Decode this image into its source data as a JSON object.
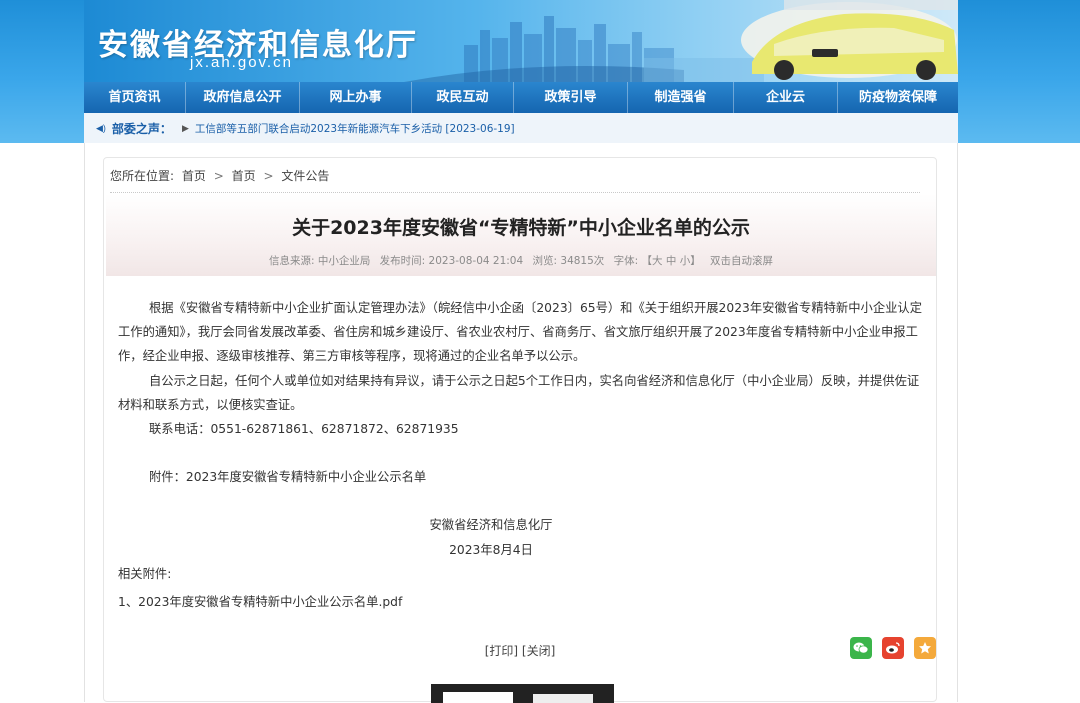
{
  "header": {
    "site_title": "安徽省经济和信息化厅",
    "site_domain": "jx.ah.gov.cn"
  },
  "nav": {
    "items": [
      "首页资讯",
      "政府信息公开",
      "网上办事",
      "政民互动",
      "政策引导",
      "制造强省",
      "企业云",
      "防疫物资保障"
    ]
  },
  "ticker": {
    "label": "部委之声：",
    "text": "工信部等五部门联合启动2023年新能源汽车下乡活动 [2023-06-19]"
  },
  "breadcrumb": {
    "prefix": "您所在位置:",
    "items": [
      "首页",
      "首页",
      "文件公告"
    ],
    "separator": ">"
  },
  "article": {
    "title": "关于2023年度安徽省“专精特新”中小企业名单的公示",
    "meta": {
      "source": "信息来源: 中小企业局",
      "time": "发布时间: 2023-08-04 21:04",
      "views": "浏览: 34815次",
      "font": "字体: 【大 中 小】",
      "scroll": "双击自动滚屏"
    },
    "para1_line1": "根据《安徽省专精特新中小企业扩面认定管理办法》（皖经信中小企函〔2023〕65号）和《关于组织开展2023年安徽省专精特新中小企业认定",
    "para1_line2": "工作的通知》，我厅会同省发展改革委、省住房和城乡建设厅、省农业农村厅、省商务厅、省文旅厅组织开展了2023年度省专精特新中小企业申报",
    "para1_line3": "工作，经企业申报、逐级审核推荐、第三方审核等程序，现将通过的企业名单予以公示。",
    "para2_line1": "自公示之日起，任何个人或单位如对结果持有异议，请于公示之日起5个工作日内，实名向省经济和信息化厅（中小企业局）反映，并提供佐证",
    "para2_line2": "材料和联系方式，以便核实查证。",
    "phone": "联系电话：0551-62871861、62871872、62871935",
    "attachment_note": "附件：2023年度安徽省专精特新中小企业公示名单",
    "signature_org": "安徽省经济和信息化厅",
    "signature_date": "2023年8月4日",
    "related_label": "相关附件:",
    "related_file": "1、2023年度安徽省专精特新中小企业公示名单.pdf"
  },
  "actions": {
    "print": "[打印]",
    "close": "[关闭]"
  },
  "colors": {
    "nav_bg": "#1565b0",
    "accent": "#1a5fa8",
    "wechat": "#3bb54a",
    "weibo": "#e6432f",
    "favorite": "#f4a93b"
  }
}
